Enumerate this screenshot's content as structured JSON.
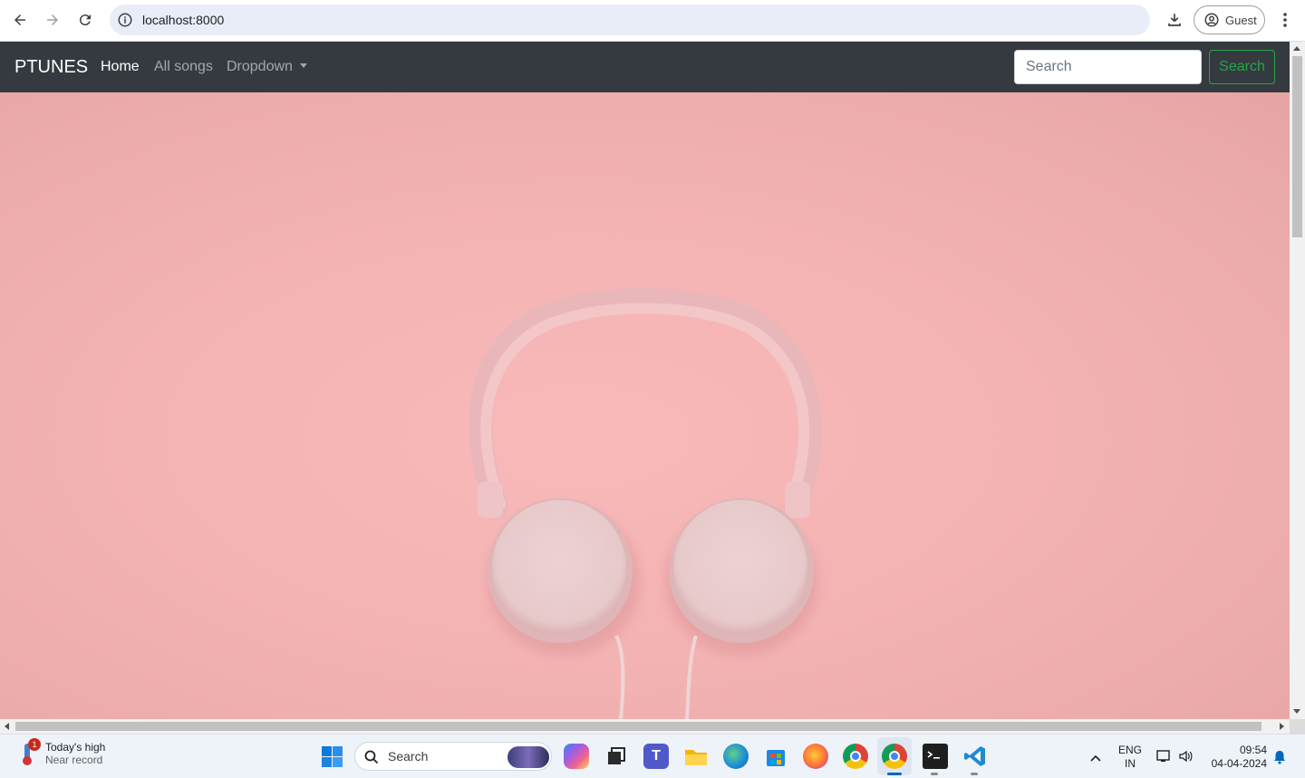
{
  "browser": {
    "url": "localhost:8000",
    "profile_label": "Guest"
  },
  "navbar": {
    "brand": "PTUNES",
    "links": [
      {
        "label": "Home",
        "active": true
      },
      {
        "label": "All songs",
        "active": false
      },
      {
        "label": "Dropdown",
        "active": false
      }
    ],
    "search_placeholder": "Search",
    "search_button": "Search"
  },
  "hero": {
    "image": "pink headphones on pink background",
    "background_color": "#f4b3b3"
  },
  "taskbar": {
    "weather_title": "Today's high",
    "weather_subtitle": "Near record",
    "weather_badge": "1",
    "search_placeholder": "Search",
    "language_line1": "ENG",
    "language_line2": "IN",
    "time": "09:54",
    "date": "04-04-2024"
  },
  "colors": {
    "navbar_bg": "#343a40",
    "success": "#28a745",
    "omnibox_bg": "#e9edf7"
  }
}
